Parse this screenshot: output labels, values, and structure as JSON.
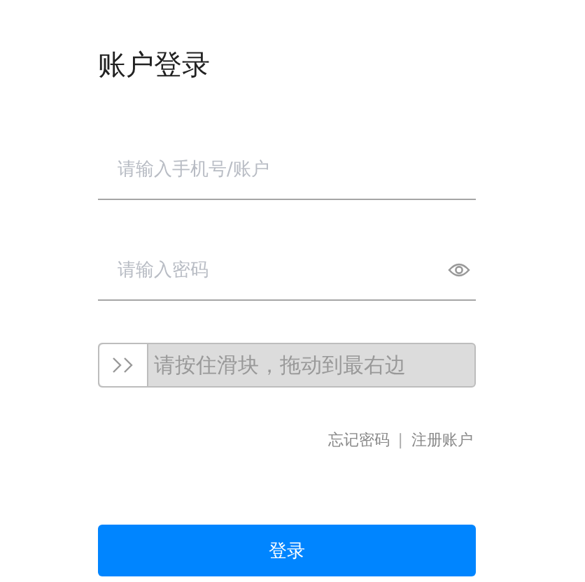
{
  "title": "账户登录",
  "fields": [
    {
      "placeholder": "请输入手机号/账户",
      "kind": "text"
    },
    {
      "placeholder": "请输入密码",
      "kind": "password"
    }
  ],
  "slider": {
    "hint": "请按住滑块，拖动到最右边"
  },
  "links": [
    {
      "label": "忘记密码"
    },
    {
      "label": "|",
      "kind": "separator"
    },
    {
      "label": "注册账户"
    }
  ],
  "submit": {
    "label": "登录"
  }
}
